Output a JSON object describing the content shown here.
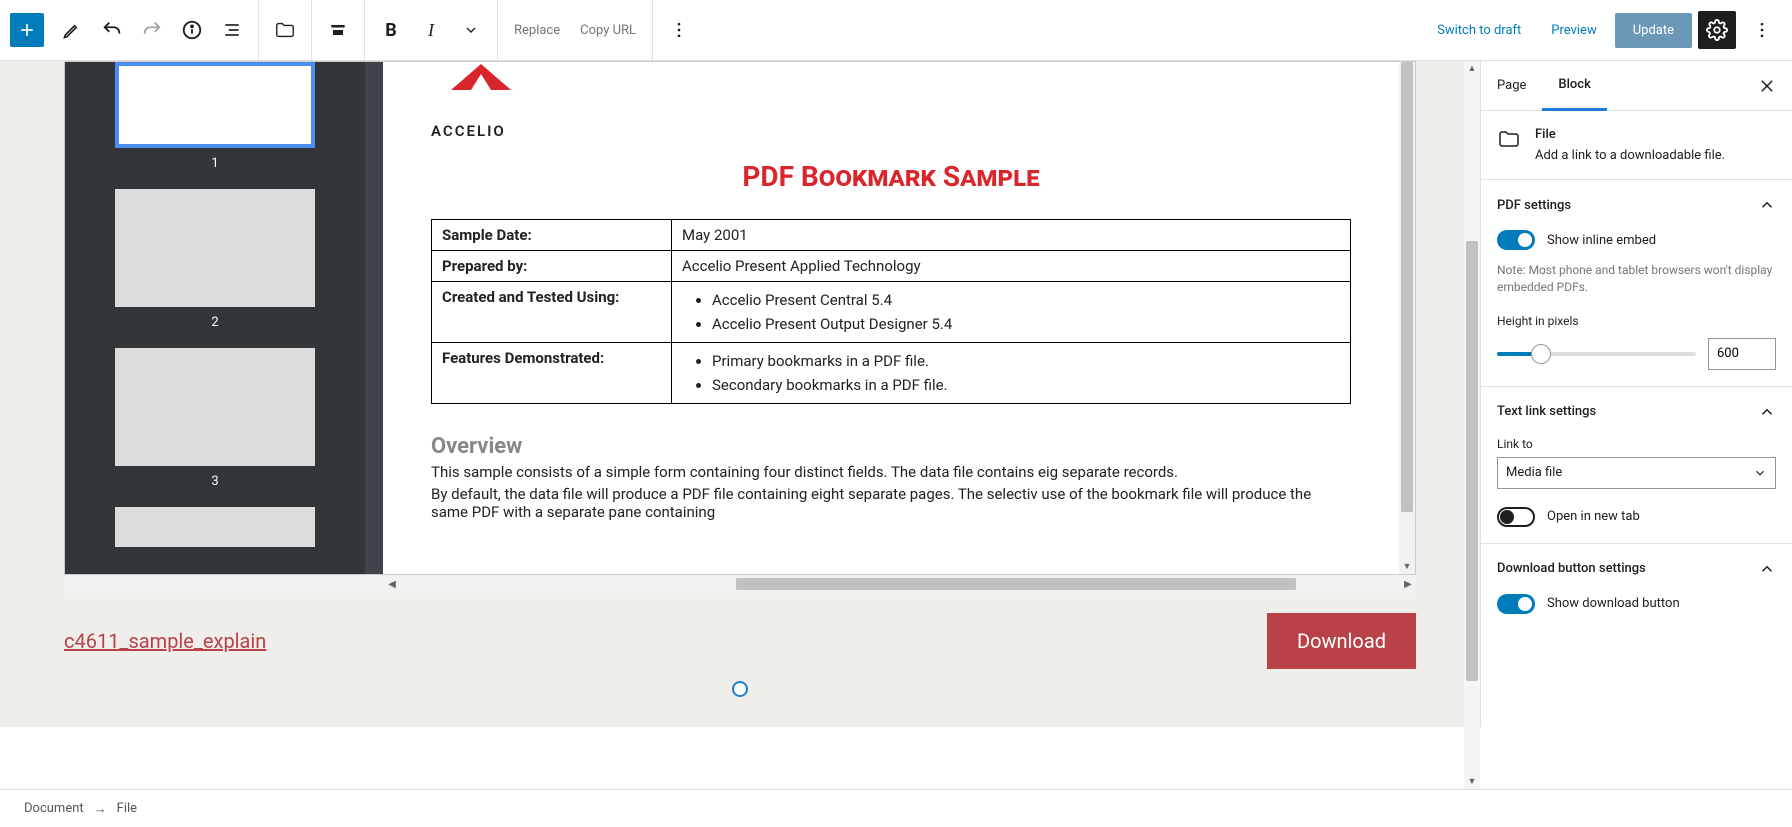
{
  "toolbar": {
    "replace": "Replace",
    "copy_url": "Copy URL",
    "switch_draft": "Switch to draft",
    "preview": "Preview",
    "update": "Update"
  },
  "pdf": {
    "logo_text": "ACCELIO",
    "title": "PDF Bookmark Sample",
    "thumbs": [
      "1",
      "2",
      "3"
    ],
    "rows": [
      {
        "label": "Sample Date:",
        "value": "May 2001"
      },
      {
        "label": "Prepared by:",
        "value": "Accelio Present Applied Technology"
      },
      {
        "label": "Created and Tested Using:",
        "list": [
          "Accelio Present Central 5.4",
          "Accelio Present Output Designer 5.4"
        ]
      },
      {
        "label": "Features Demonstrated:",
        "list": [
          "Primary bookmarks in a PDF file.",
          "Secondary bookmarks in a PDF file."
        ]
      }
    ],
    "overview_heading": "Overview",
    "overview_p1": "This sample consists of a simple form containing four distinct fields. The data file contains eig separate records.",
    "overview_p2": "By default, the data file will produce a PDF file containing eight separate pages. The selectiv use of the bookmark file will produce the same PDF with a separate pane containing"
  },
  "file_block": {
    "filename": "c4611_sample_explain",
    "download": "Download"
  },
  "sidebar": {
    "tab_page": "Page",
    "tab_block": "Block",
    "block_name": "File",
    "block_desc": "Add a link to a downloadable file.",
    "pdf_settings": "PDF settings",
    "show_inline": "Show inline embed",
    "inline_note": "Note: Most phone and tablet browsers won't display embedded PDFs.",
    "height_label": "Height in pixels",
    "height_value": "600",
    "text_link_settings": "Text link settings",
    "link_to": "Link to",
    "link_to_value": "Media file",
    "open_new_tab": "Open in new tab",
    "download_btn_settings": "Download button settings",
    "show_download": "Show download button"
  },
  "breadcrumb": {
    "root": "Document",
    "sep": "→",
    "leaf": "File"
  }
}
